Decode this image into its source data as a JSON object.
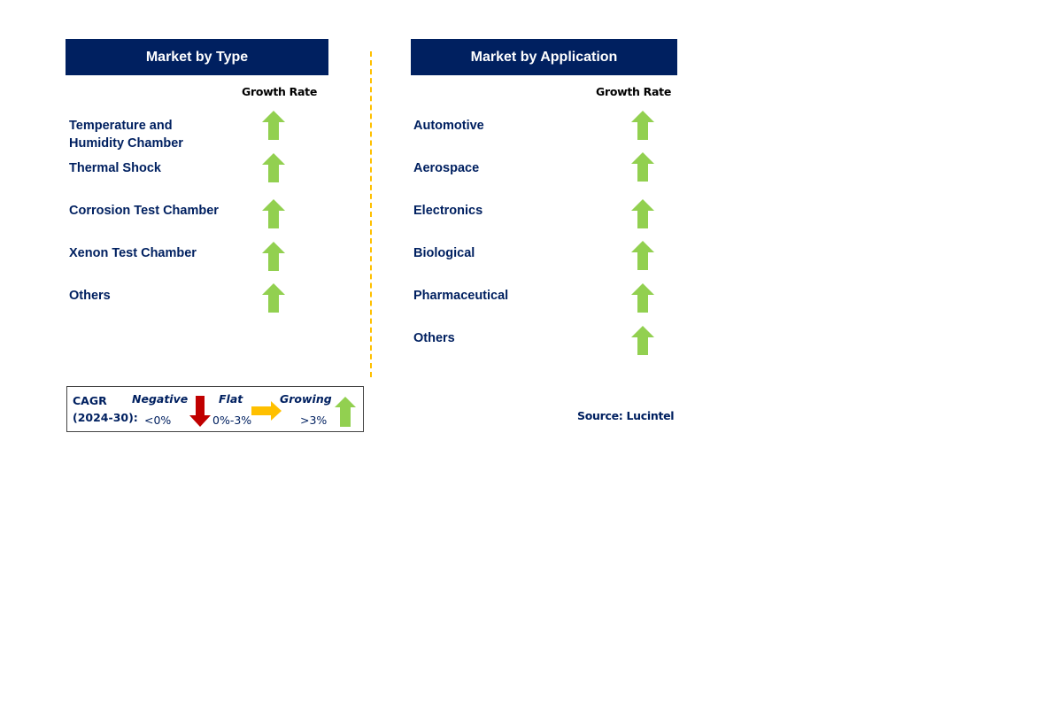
{
  "type_panel": {
    "title": "Market by Type",
    "growth_header": "Growth Rate",
    "items": [
      {
        "label_line1": "Temperature and",
        "label_line2": "Humidity Chamber",
        "trend": "up"
      },
      {
        "label": "Thermal Shock",
        "trend": "up"
      },
      {
        "label": "Corrosion Test Chamber",
        "trend": "up"
      },
      {
        "label": "Xenon Test Chamber",
        "trend": "up"
      },
      {
        "label": "Others",
        "trend": "up"
      }
    ]
  },
  "application_panel": {
    "title": "Market by Application",
    "growth_header": "Growth Rate",
    "items": [
      {
        "label": "Automotive",
        "trend": "up"
      },
      {
        "label": "Aerospace",
        "trend": "up"
      },
      {
        "label": "Electronics",
        "trend": "up"
      },
      {
        "label": "Biological",
        "trend": "up"
      },
      {
        "label": "Pharmaceutical",
        "trend": "up"
      },
      {
        "label": "Others",
        "trend": "up"
      }
    ]
  },
  "legend": {
    "cagr": "CAGR",
    "period": "(2024-30):",
    "negative": "Negative",
    "negative_range": "<0%",
    "flat": "Flat",
    "flat_range": "0%-3%",
    "growing": "Growing",
    "growing_range": ">3%"
  },
  "source": "Source: Lucintel",
  "colors": {
    "header": "#002060",
    "up": "#92D050",
    "down": "#C00000",
    "flat": "#FFC000",
    "divider": "#FFC000"
  }
}
